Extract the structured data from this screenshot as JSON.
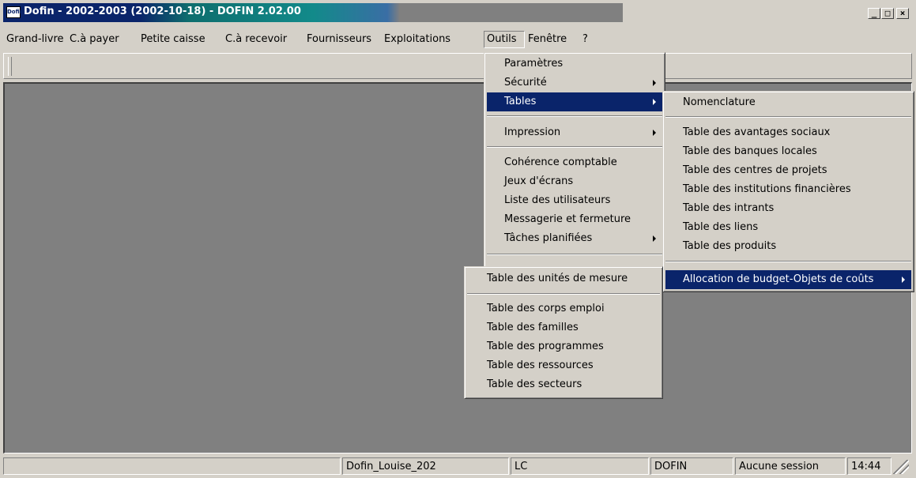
{
  "window": {
    "title": "Dofin - 2002-2003 (2002-10-18) - DOFIN 2.02.00",
    "icon_label": "Dofin",
    "minimize": "_",
    "maximize": "□",
    "close": "×"
  },
  "menubar": {
    "items": [
      "Grand-livre",
      "C.à payer",
      "Petite caisse",
      "C.à recevoir",
      "Fournisseurs",
      "Exploitations",
      "Outils",
      "Fenêtre",
      "?"
    ],
    "open_item": "Outils"
  },
  "outils_menu": {
    "items": [
      {
        "label": "Paramètres"
      },
      {
        "label": "Sécurité",
        "submenu": true
      },
      {
        "label": "Tables",
        "submenu": true,
        "highlighted": true
      },
      {
        "label": "Impression",
        "submenu": true
      },
      {
        "label": "Cohérence comptable"
      },
      {
        "label": "Jeux d'écrans"
      },
      {
        "label": "Liste des utilisateurs"
      },
      {
        "label": "Messagerie et fermeture"
      },
      {
        "label": "Tâches planifiées",
        "submenu": true
      }
    ]
  },
  "tables_menu": {
    "items": [
      {
        "label": "Nomenclature"
      },
      {
        "label": "Table des avantages sociaux"
      },
      {
        "label": "Table des banques locales"
      },
      {
        "label": "Table des centres de projets"
      },
      {
        "label": "Table des institutions financières"
      },
      {
        "label": "Table des intrants"
      },
      {
        "label": "Table des liens"
      },
      {
        "label": "Table des produits"
      },
      {
        "label": "Allocation de budget-Objets de coûts",
        "submenu": true,
        "highlighted": true
      }
    ]
  },
  "unites_menu": {
    "items": [
      {
        "label": "Table des unités de mesure"
      },
      {
        "label": "Table des corps emploi"
      },
      {
        "label": "Table des familles"
      },
      {
        "label": "Table des programmes"
      },
      {
        "label": "Table des ressources"
      },
      {
        "label": "Table des secteurs"
      }
    ]
  },
  "statusbar": {
    "panes": [
      "",
      "Dofin_Louise_202",
      "LC",
      "DOFIN",
      "Aucune session",
      "14:44"
    ]
  },
  "colors": {
    "face": "#d4d0c8",
    "highlight": "#0a246a",
    "client": "#808080"
  }
}
